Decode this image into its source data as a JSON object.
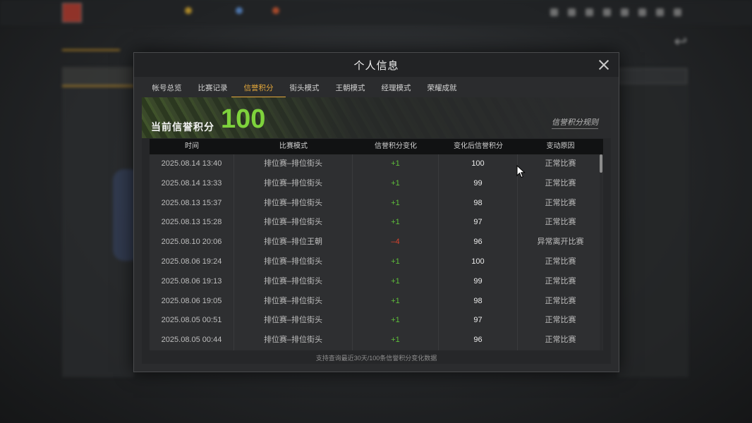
{
  "modal": {
    "title": "个人信息",
    "tabs": [
      "帐号总览",
      "比赛记录",
      "信誉积分",
      "街头模式",
      "王朝模式",
      "经理模式",
      "荣耀成就"
    ],
    "active_tab": "信誉积分"
  },
  "banner": {
    "label": "当前信誉积分",
    "score": "100",
    "rules_link": "信誉积分规则"
  },
  "table": {
    "headers": [
      "时间",
      "比赛模式",
      "信誉积分变化",
      "变化后信誉积分",
      "变动原因"
    ],
    "rows": [
      {
        "time": "2025.08.14  13:40",
        "mode": "排位赛–排位街头",
        "change": "+1",
        "after": "100",
        "reason": "正常比赛"
      },
      {
        "time": "2025.08.14  13:33",
        "mode": "排位赛–排位街头",
        "change": "+1",
        "after": "99",
        "reason": "正常比赛"
      },
      {
        "time": "2025.08.13  15:37",
        "mode": "排位赛–排位街头",
        "change": "+1",
        "after": "98",
        "reason": "正常比赛"
      },
      {
        "time": "2025.08.13  15:28",
        "mode": "排位赛–排位街头",
        "change": "+1",
        "after": "97",
        "reason": "正常比赛"
      },
      {
        "time": "2025.08.10  20:06",
        "mode": "排位赛–排位王朝",
        "change": "–4",
        "after": "96",
        "reason": "异常离开比赛"
      },
      {
        "time": "2025.08.06  19:24",
        "mode": "排位赛–排位街头",
        "change": "+1",
        "after": "100",
        "reason": "正常比赛"
      },
      {
        "time": "2025.08.06  19:13",
        "mode": "排位赛–排位街头",
        "change": "+1",
        "after": "99",
        "reason": "正常比赛"
      },
      {
        "time": "2025.08.06  19:05",
        "mode": "排位赛–排位街头",
        "change": "+1",
        "after": "98",
        "reason": "正常比赛"
      },
      {
        "time": "2025.08.05  00:51",
        "mode": "排位赛–排位街头",
        "change": "+1",
        "after": "97",
        "reason": "正常比赛"
      },
      {
        "time": "2025.08.05  00:44",
        "mode": "排位赛–排位街头",
        "change": "+1",
        "after": "96",
        "reason": "正常比赛"
      }
    ],
    "footer_note": "支持查询最近30天/100条信誉积分变化数据"
  },
  "colors": {
    "accent": "#e6a93a",
    "score_green": "#7ed23c",
    "positive": "#5fbf3a",
    "negative": "#d6422d"
  },
  "icons": {
    "close": "close-icon",
    "cursor": "mouse-cursor-icon"
  }
}
